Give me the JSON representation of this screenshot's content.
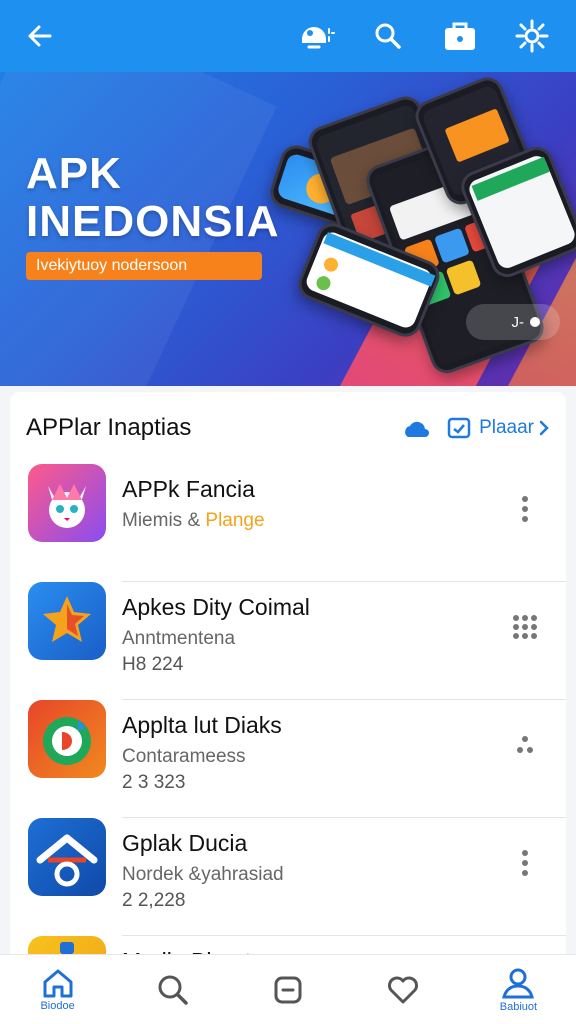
{
  "topbar": {
    "icons": [
      "back-arrow-icon",
      "cloud-icon",
      "search-icon",
      "briefcase-icon",
      "settings-icon"
    ]
  },
  "hero": {
    "title_line1": "APK",
    "title_line2": "INEDONSIA",
    "tagline": "Ivekiytuoy nodersoon",
    "pill_text": "J-"
  },
  "list": {
    "title": "APPlar Inaptias",
    "link_label": "Plaaar",
    "apps": [
      {
        "name": "APPk Fancia",
        "sub": "Miemis &",
        "sub_highlight": "Plange",
        "meta": ""
      },
      {
        "name": "Apkes Dity Coimal",
        "sub": "Anntmentena",
        "sub_highlight": "",
        "meta": "H8 224"
      },
      {
        "name": "Applta lut Diaks",
        "sub": "Contarameess",
        "sub_highlight": "",
        "meta": "2 3 323"
      },
      {
        "name": "Gplak Ducia",
        "sub": "Nordek &yahrasiad",
        "sub_highlight": "",
        "meta": "2 2,228"
      },
      {
        "name": "Madla Blaarta",
        "sub": "",
        "sub_highlight": "",
        "meta": ""
      }
    ]
  },
  "bottomnav": {
    "items": [
      {
        "label": "Biodoe",
        "icon": "home-icon"
      },
      {
        "label": "",
        "icon": "search-icon"
      },
      {
        "label": "",
        "icon": "square-icon"
      },
      {
        "label": "",
        "icon": "heart-icon"
      },
      {
        "label": "Babiuot",
        "icon": "profile-icon"
      }
    ]
  },
  "colors": {
    "primary": "#1e90f0",
    "accent_orange": "#f7821b",
    "link_blue": "#1e7ae0",
    "highlight_yellow": "#f5a31a"
  }
}
